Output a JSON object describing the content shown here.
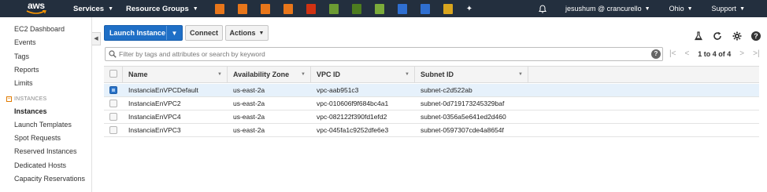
{
  "nav": {
    "logo_text": "aws",
    "services_label": "Services",
    "resource_groups_label": "Resource Groups",
    "service_icons": [
      {
        "name": "ec2-service-icon",
        "color": "#e8761a"
      },
      {
        "name": "lambda-service-icon",
        "color": "#e8761a"
      },
      {
        "name": "lightsail-service-icon",
        "color": "#e8761a"
      },
      {
        "name": "beanstalk-service-icon",
        "color": "#e8761a"
      },
      {
        "name": "cloudformation-service-icon",
        "color": "#d13212"
      },
      {
        "name": "s3-service-icon",
        "color": "#6c9b33"
      },
      {
        "name": "glacier-service-icon",
        "color": "#4d7c1f"
      },
      {
        "name": "iam-key-service-icon",
        "color": "#7bab3a"
      },
      {
        "name": "rds-service-icon",
        "color": "#2f6fd1"
      },
      {
        "name": "dynamodb-service-icon",
        "color": "#2f6fd1"
      },
      {
        "name": "cloudfront-service-icon",
        "color": "#d9a51e"
      },
      {
        "name": "pin-icon",
        "color": "#ffffff"
      }
    ],
    "user_label": "jesushum @ crancurello",
    "region_label": "Ohio",
    "support_label": "Support"
  },
  "sidebar": {
    "items_top": [
      "EC2 Dashboard",
      "Events",
      "Tags",
      "Reports",
      "Limits"
    ],
    "section_label": "INSTANCES",
    "items_instances": [
      "Instances",
      "Launch Templates",
      "Spot Requests",
      "Reserved Instances",
      "Dedicated Hosts",
      "Capacity Reservations"
    ],
    "active_item": "Instances",
    "collapse_glyph": "◀"
  },
  "toolbar": {
    "launch_label": "Launch Instance",
    "connect_label": "Connect",
    "actions_label": "Actions"
  },
  "search": {
    "placeholder": "Filter by tags and attributes or search by keyword",
    "help_glyph": "?"
  },
  "pagination": {
    "text": "1 to 4 of 4"
  },
  "table": {
    "columns": [
      "Name",
      "Availability Zone",
      "VPC ID",
      "Subnet ID"
    ],
    "rows": [
      {
        "selected": true,
        "cells": [
          "InstanciaEnVPCDefault",
          "us-east-2a",
          "vpc-aab951c3",
          "subnet-c2d522ab"
        ]
      },
      {
        "selected": false,
        "cells": [
          "InstanciaEnVPC2",
          "us-east-2a",
          "vpc-010606f9f684bc4a1",
          "subnet-0d719173245329baf"
        ]
      },
      {
        "selected": false,
        "cells": [
          "InstanciaEnVPC4",
          "us-east-2a",
          "vpc-082122f390fd1efd2",
          "subnet-0356a5e641ed2d460"
        ]
      },
      {
        "selected": false,
        "cells": [
          "InstanciaEnVPC3",
          "us-east-2a",
          "vpc-045fa1c9252dfe6e3",
          "subnet-0597307cde4a8654f"
        ]
      }
    ]
  },
  "colors": {
    "nav_bg": "#232f3e",
    "primary_button": "#1f6fc6",
    "selected_row": "#e6f1fb",
    "accent_orange": "#e07b00"
  }
}
